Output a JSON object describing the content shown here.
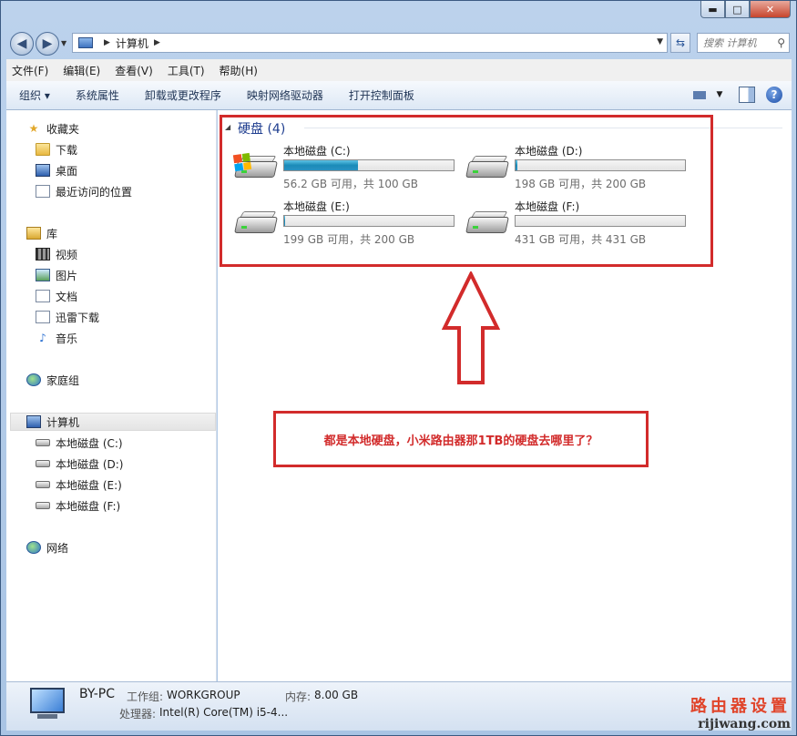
{
  "window": {
    "controls": {
      "minimize": "▬",
      "maximize": "□",
      "close": "✕"
    }
  },
  "address_bar": {
    "path": [
      "计算机"
    ],
    "search_placeholder": "搜索 计算机"
  },
  "menu": [
    "文件(F)",
    "编辑(E)",
    "查看(V)",
    "工具(T)",
    "帮助(H)"
  ],
  "command_bar": {
    "items": [
      "组织 ▾",
      "系统属性",
      "卸载或更改程序",
      "映射网络驱动器",
      "打开控制面板"
    ]
  },
  "nav": {
    "favorites": {
      "label": "收藏夹",
      "items": [
        "下载",
        "桌面",
        "最近访问的位置"
      ]
    },
    "libraries": {
      "label": "库",
      "items": [
        "视频",
        "图片",
        "文档",
        "迅雷下载",
        "音乐"
      ]
    },
    "homegroup": "家庭组",
    "computer": {
      "label": "计算机",
      "items": [
        "本地磁盘 (C:)",
        "本地磁盘 (D:)",
        "本地磁盘 (E:)",
        "本地磁盘 (F:)"
      ]
    },
    "network": "网络"
  },
  "content": {
    "group_title": "硬盘 (4)",
    "drives": [
      {
        "name": "本地磁盘 (C:)",
        "info": "56.2 GB 可用，共 100 GB",
        "used_fraction": 0.438,
        "system": true
      },
      {
        "name": "本地磁盘 (D:)",
        "info": "198 GB 可用，共 200 GB",
        "used_fraction": 0.01,
        "system": false
      },
      {
        "name": "本地磁盘 (E:)",
        "info": "199 GB 可用，共 200 GB",
        "used_fraction": 0.005,
        "system": false
      },
      {
        "name": "本地磁盘 (F:)",
        "info": "431 GB 可用，共 431 GB",
        "used_fraction": 0.0,
        "system": false
      }
    ]
  },
  "annotation": {
    "note": "都是本地硬盘，小米路由器那1TB的硬盘去哪里了？",
    "color": "#d22b2b"
  },
  "details": {
    "pc_name": "BY-PC",
    "workgroup_label": "工作组:",
    "workgroup": "WORKGROUP",
    "memory_label": "内存:",
    "memory": "8.00 GB",
    "cpu_label": "处理器:",
    "cpu": "Intel(R) Core(TM) i5-4..."
  },
  "watermark": {
    "cn": "路由器设置",
    "en": "rijiwang.com"
  }
}
